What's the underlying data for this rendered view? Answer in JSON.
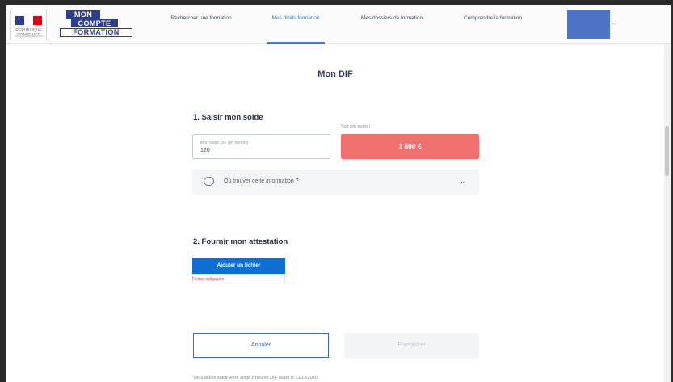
{
  "header": {
    "republique": "RÉPUBLIQUE FRANÇAISE",
    "logo": {
      "line1": "MON",
      "line2": "COMPTE",
      "line3": "FORMATION"
    },
    "nav": [
      {
        "label": "Rechercher une formation",
        "active": false
      },
      {
        "label": "Mes droits formation",
        "active": true
      },
      {
        "label": "Mes dossiers de formation",
        "active": false
      },
      {
        "label": "Comprendre la formation",
        "active": false
      }
    ],
    "nav_tail": "…"
  },
  "page": {
    "title": "Mon DIF"
  },
  "section1": {
    "title": "1. Saisir mon solde",
    "hours_field": {
      "label": "Mon solde DIF (en heures)",
      "value": "120"
    },
    "euro_label": "Soit (en euros) :",
    "euro_value": "1 800 €",
    "help_text": "Où trouver cette information ?"
  },
  "section2": {
    "title": "2. Fournir mon attestation",
    "upload_label": "Ajouter un fichier",
    "error_text": "Fichier obligatoire"
  },
  "actions": {
    "cancel": "Annuler",
    "save": "Enregistrer"
  },
  "footnote": "Vous devez saisir votre solde d'heures DIF avant le 31/12/2020",
  "colors": {
    "accent": "#0d6fd1",
    "euro_box": "#f06f6f",
    "brand": "#2b3e8c"
  }
}
